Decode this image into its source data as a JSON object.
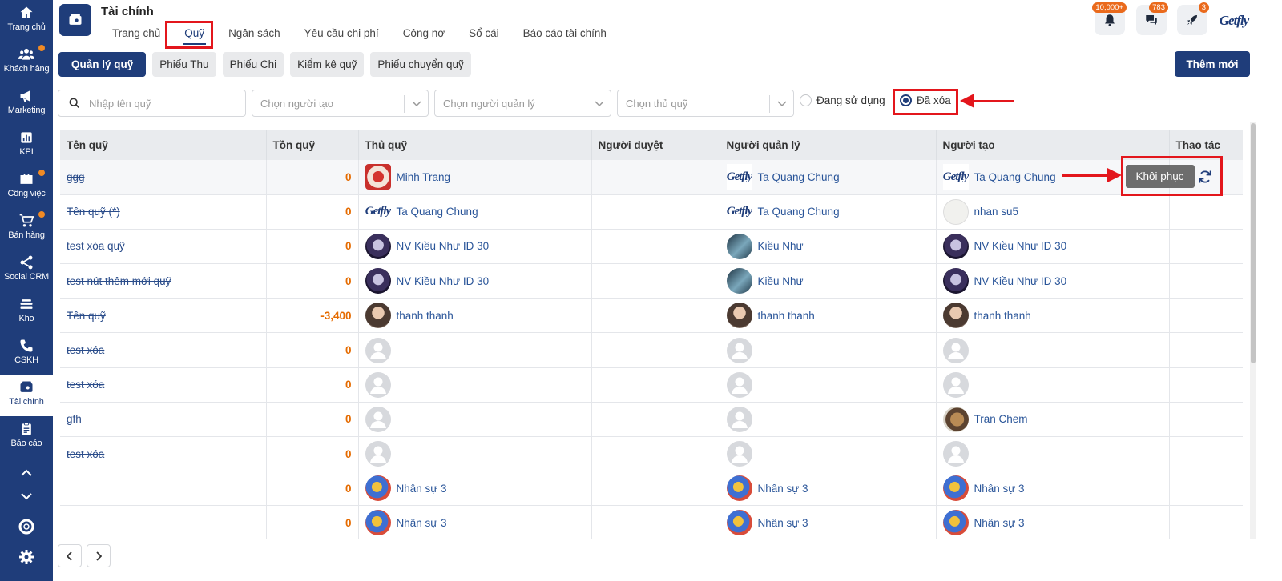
{
  "sidebar": {
    "items": [
      {
        "label": "Trang chủ",
        "icon": "home-icon"
      },
      {
        "label": "Khách hàng",
        "icon": "users-icon"
      },
      {
        "label": "Marketing",
        "icon": "megaphone-icon"
      },
      {
        "label": "KPI",
        "icon": "chart-icon"
      },
      {
        "label": "Công việc",
        "icon": "briefcase-icon"
      },
      {
        "label": "Bán hàng",
        "icon": "cart-icon"
      },
      {
        "label": "Social CRM",
        "icon": "share-icon"
      },
      {
        "label": "Kho",
        "icon": "warehouse-icon"
      },
      {
        "label": "CSKH",
        "icon": "phone-icon"
      },
      {
        "label": "Tài chính",
        "icon": "wallet-icon"
      },
      {
        "label": "Báo cáo",
        "icon": "report-icon"
      }
    ]
  },
  "header": {
    "title": "Tài chính",
    "tabs": [
      "Trang chủ",
      "Quỹ",
      "Ngân sách",
      "Yêu cầu chi phí",
      "Công nợ",
      "Sổ cái",
      "Báo cáo tài chính"
    ],
    "active_tab": "Quỹ",
    "notifications_badge": "10,000+",
    "messages_badge": "783",
    "rocket_badge": "3",
    "brand": "Getfly"
  },
  "subtabs": [
    "Quản lý quỹ",
    "Phiếu Thu",
    "Phiếu Chi",
    "Kiểm kê quỹ",
    "Phiếu chuyển quỹ"
  ],
  "add_button": "Thêm mới",
  "filters": {
    "search_placeholder": "Nhập tên quỹ",
    "creator_placeholder": "Chọn người tạo",
    "manager_placeholder": "Chọn người quản lý",
    "treasurer_placeholder": "Chọn thủ quỹ",
    "radio_active": "Đang sử dụng",
    "radio_deleted": "Đã xóa",
    "selected": "Đã xóa"
  },
  "table": {
    "columns": [
      "Tên quỹ",
      "Tồn quỹ",
      "Thủ quỹ",
      "Người duyệt",
      "Người quản lý",
      "Người tạo",
      "Thao tác"
    ],
    "restore_label": "Khôi phục",
    "rows": [
      {
        "name": "ggg",
        "balance": "0",
        "treasurer": "Minh Trang",
        "t_av": "gift",
        "approver": "",
        "manager": "Ta Quang Chung",
        "m_av": "logo",
        "creator": "Ta Quang Chung",
        "c_av": "logo"
      },
      {
        "name": "Tên quỹ (*)",
        "balance": "0",
        "treasurer": "Ta Quang Chung",
        "t_av": "logo",
        "approver": "",
        "manager": "Ta Quang Chung",
        "m_av": "logo",
        "creator": "nhan su5",
        "c_av": "ghost"
      },
      {
        "name": "test xóa quỹ",
        "balance": "0",
        "treasurer": "NV Kiều Như ID 30",
        "t_av": "dark",
        "approver": "",
        "manager": "Kiều Như",
        "m_av": "blue",
        "creator": "NV Kiều Như ID 30",
        "c_av": "dark"
      },
      {
        "name": "test nút thêm mới quỹ",
        "balance": "0",
        "treasurer": "NV Kiều Như ID 30",
        "t_av": "dark",
        "approver": "",
        "manager": "Kiều Như",
        "m_av": "blue",
        "creator": "NV Kiều Như ID 30",
        "c_av": "dark"
      },
      {
        "name": "Tên quỹ",
        "balance": "-3,400",
        "treasurer": "thanh thanh",
        "t_av": "photo",
        "approver": "",
        "manager": "thanh thanh",
        "m_av": "photo",
        "creator": "thanh thanh",
        "c_av": "photo"
      },
      {
        "name": "test xóa",
        "balance": "0",
        "treasurer": "",
        "t_av": "blank",
        "approver": "",
        "manager": "",
        "m_av": "blank",
        "creator": "",
        "c_av": "blank"
      },
      {
        "name": "test xóa",
        "balance": "0",
        "treasurer": "",
        "t_av": "blank",
        "approver": "",
        "manager": "",
        "m_av": "blank",
        "creator": "",
        "c_av": "blank"
      },
      {
        "name": "gfh",
        "balance": "0",
        "treasurer": "",
        "t_av": "blank",
        "approver": "",
        "manager": "",
        "m_av": "blank",
        "creator": "Tran Chem",
        "c_av": "dog"
      },
      {
        "name": "test xóa",
        "balance": "0",
        "treasurer": "",
        "t_av": "blank",
        "approver": "",
        "manager": "",
        "m_av": "blank",
        "creator": "",
        "c_av": "blank"
      },
      {
        "name": "",
        "balance": "0",
        "treasurer": "Nhân sự 3",
        "t_av": "kid",
        "approver": "",
        "manager": "Nhân sự 3",
        "m_av": "kid",
        "creator": "Nhân sự 3",
        "c_av": "kid"
      },
      {
        "name": "",
        "balance": "0",
        "treasurer": "Nhân sự 3",
        "t_av": "kid",
        "approver": "",
        "manager": "Nhân sự 3",
        "m_av": "kid",
        "creator": "Nhân sự 3",
        "c_av": "kid"
      }
    ]
  },
  "colors": {
    "primary": "#1f3d7a",
    "accent_orange": "#e56b00",
    "annotation_red": "#e3161c",
    "restore_gray": "#6d6d6d"
  }
}
